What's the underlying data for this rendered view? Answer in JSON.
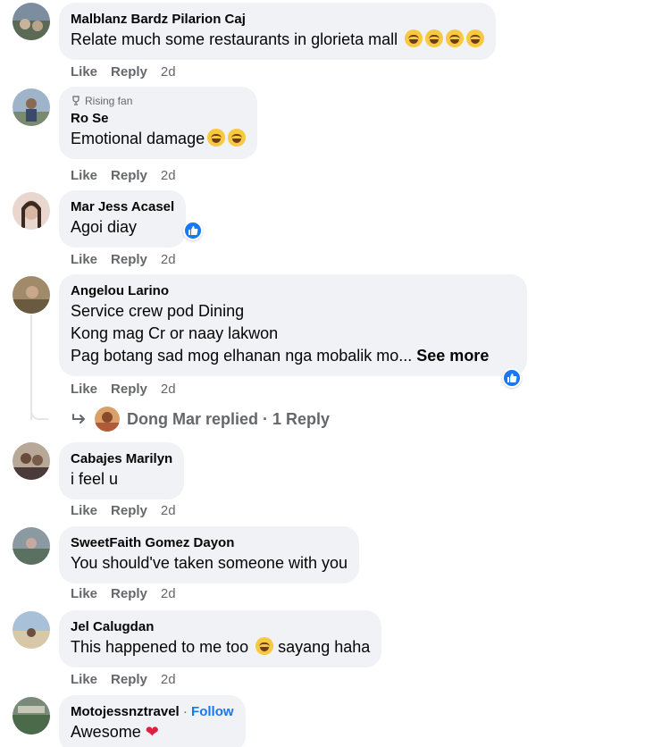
{
  "colors": {
    "bubble": "#f0f2f5",
    "muted": "#65676b",
    "link": "#1877f2",
    "reaction_like": "#1877f2",
    "heart": "#e41e3f"
  },
  "actions": {
    "like": "Like",
    "reply": "Reply"
  },
  "comments": [
    {
      "author": "Malblanz Bardz Pilarion Caj",
      "text": "Relate much some restaurants in glorieta mall",
      "emoji": "rolling-on-floor-laughing x4",
      "time": "2d"
    },
    {
      "badge": "Rising fan",
      "author": "Ro Se",
      "text": "Emotional damage",
      "emoji": "tears-of-joy x2",
      "time": "2d"
    },
    {
      "author": "Mar Jess Acasel",
      "text": "Agoi diay",
      "reaction": "like-icon",
      "time": "2d"
    },
    {
      "author": "Angelou Larino",
      "lines": [
        "Service crew pod Dining",
        "Kong mag Cr or naay lakwon",
        "Pag botang sad mog elhanan nga mobalik mo..."
      ],
      "see_more": "See more",
      "reaction": "like-icon",
      "time": "2d"
    },
    {
      "author": "Cabajes Marilyn",
      "text": "i feel u",
      "time": "2d"
    },
    {
      "author": "SweetFaith Gomez Dayon",
      "text": "You should've taken someone with you",
      "time": "2d"
    },
    {
      "author": "Jel Calugdan",
      "text_before": "This happened to me too",
      "text_after": " sayang haha",
      "emoji": "tears-of-joy",
      "time": "2d"
    },
    {
      "author": "Motojessnztravel Follow",
      "author_name": "Motojessnztravel",
      "dot": "·",
      "follow": "Follow",
      "text": "Awesome",
      "emoji": "red-heart"
    }
  ],
  "reply_summary": {
    "text": "Dong Mar replied · 1 Reply"
  }
}
